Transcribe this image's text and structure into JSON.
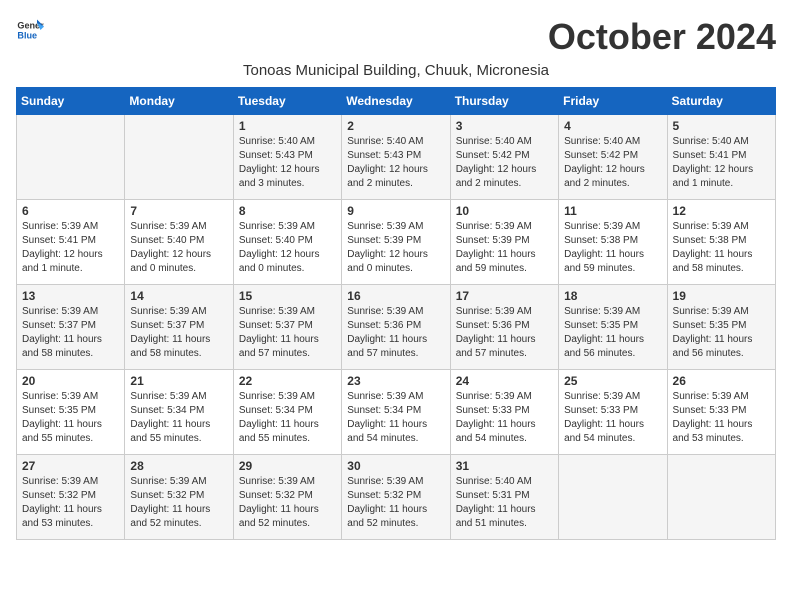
{
  "logo": {
    "general": "General",
    "blue": "Blue"
  },
  "title": "October 2024",
  "subtitle": "Tonoas Municipal Building, Chuuk, Micronesia",
  "days_of_week": [
    "Sunday",
    "Monday",
    "Tuesday",
    "Wednesday",
    "Thursday",
    "Friday",
    "Saturday"
  ],
  "weeks": [
    [
      {
        "day": "",
        "info": ""
      },
      {
        "day": "",
        "info": ""
      },
      {
        "day": "1",
        "info": "Sunrise: 5:40 AM\nSunset: 5:43 PM\nDaylight: 12 hours and 3 minutes."
      },
      {
        "day": "2",
        "info": "Sunrise: 5:40 AM\nSunset: 5:43 PM\nDaylight: 12 hours and 2 minutes."
      },
      {
        "day": "3",
        "info": "Sunrise: 5:40 AM\nSunset: 5:42 PM\nDaylight: 12 hours and 2 minutes."
      },
      {
        "day": "4",
        "info": "Sunrise: 5:40 AM\nSunset: 5:42 PM\nDaylight: 12 hours and 2 minutes."
      },
      {
        "day": "5",
        "info": "Sunrise: 5:40 AM\nSunset: 5:41 PM\nDaylight: 12 hours and 1 minute."
      }
    ],
    [
      {
        "day": "6",
        "info": "Sunrise: 5:39 AM\nSunset: 5:41 PM\nDaylight: 12 hours and 1 minute."
      },
      {
        "day": "7",
        "info": "Sunrise: 5:39 AM\nSunset: 5:40 PM\nDaylight: 12 hours and 0 minutes."
      },
      {
        "day": "8",
        "info": "Sunrise: 5:39 AM\nSunset: 5:40 PM\nDaylight: 12 hours and 0 minutes."
      },
      {
        "day": "9",
        "info": "Sunrise: 5:39 AM\nSunset: 5:39 PM\nDaylight: 12 hours and 0 minutes."
      },
      {
        "day": "10",
        "info": "Sunrise: 5:39 AM\nSunset: 5:39 PM\nDaylight: 11 hours and 59 minutes."
      },
      {
        "day": "11",
        "info": "Sunrise: 5:39 AM\nSunset: 5:38 PM\nDaylight: 11 hours and 59 minutes."
      },
      {
        "day": "12",
        "info": "Sunrise: 5:39 AM\nSunset: 5:38 PM\nDaylight: 11 hours and 58 minutes."
      }
    ],
    [
      {
        "day": "13",
        "info": "Sunrise: 5:39 AM\nSunset: 5:37 PM\nDaylight: 11 hours and 58 minutes."
      },
      {
        "day": "14",
        "info": "Sunrise: 5:39 AM\nSunset: 5:37 PM\nDaylight: 11 hours and 58 minutes."
      },
      {
        "day": "15",
        "info": "Sunrise: 5:39 AM\nSunset: 5:37 PM\nDaylight: 11 hours and 57 minutes."
      },
      {
        "day": "16",
        "info": "Sunrise: 5:39 AM\nSunset: 5:36 PM\nDaylight: 11 hours and 57 minutes."
      },
      {
        "day": "17",
        "info": "Sunrise: 5:39 AM\nSunset: 5:36 PM\nDaylight: 11 hours and 57 minutes."
      },
      {
        "day": "18",
        "info": "Sunrise: 5:39 AM\nSunset: 5:35 PM\nDaylight: 11 hours and 56 minutes."
      },
      {
        "day": "19",
        "info": "Sunrise: 5:39 AM\nSunset: 5:35 PM\nDaylight: 11 hours and 56 minutes."
      }
    ],
    [
      {
        "day": "20",
        "info": "Sunrise: 5:39 AM\nSunset: 5:35 PM\nDaylight: 11 hours and 55 minutes."
      },
      {
        "day": "21",
        "info": "Sunrise: 5:39 AM\nSunset: 5:34 PM\nDaylight: 11 hours and 55 minutes."
      },
      {
        "day": "22",
        "info": "Sunrise: 5:39 AM\nSunset: 5:34 PM\nDaylight: 11 hours and 55 minutes."
      },
      {
        "day": "23",
        "info": "Sunrise: 5:39 AM\nSunset: 5:34 PM\nDaylight: 11 hours and 54 minutes."
      },
      {
        "day": "24",
        "info": "Sunrise: 5:39 AM\nSunset: 5:33 PM\nDaylight: 11 hours and 54 minutes."
      },
      {
        "day": "25",
        "info": "Sunrise: 5:39 AM\nSunset: 5:33 PM\nDaylight: 11 hours and 54 minutes."
      },
      {
        "day": "26",
        "info": "Sunrise: 5:39 AM\nSunset: 5:33 PM\nDaylight: 11 hours and 53 minutes."
      }
    ],
    [
      {
        "day": "27",
        "info": "Sunrise: 5:39 AM\nSunset: 5:32 PM\nDaylight: 11 hours and 53 minutes."
      },
      {
        "day": "28",
        "info": "Sunrise: 5:39 AM\nSunset: 5:32 PM\nDaylight: 11 hours and 52 minutes."
      },
      {
        "day": "29",
        "info": "Sunrise: 5:39 AM\nSunset: 5:32 PM\nDaylight: 11 hours and 52 minutes."
      },
      {
        "day": "30",
        "info": "Sunrise: 5:39 AM\nSunset: 5:32 PM\nDaylight: 11 hours and 52 minutes."
      },
      {
        "day": "31",
        "info": "Sunrise: 5:40 AM\nSunset: 5:31 PM\nDaylight: 11 hours and 51 minutes."
      },
      {
        "day": "",
        "info": ""
      },
      {
        "day": "",
        "info": ""
      }
    ]
  ]
}
